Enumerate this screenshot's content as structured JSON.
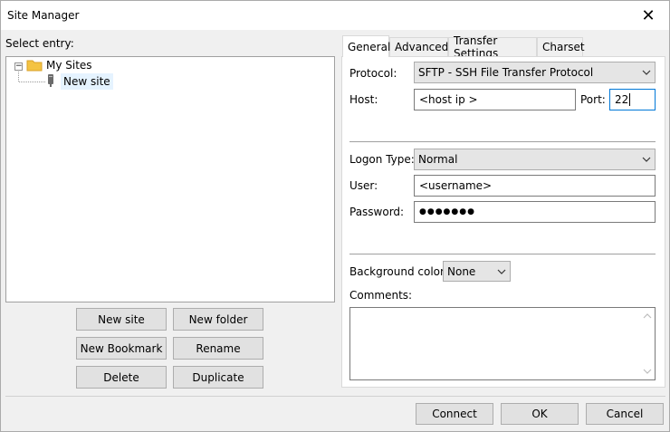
{
  "window": {
    "title": "Site Manager"
  },
  "left": {
    "select_entry_label": "Select entry:",
    "tree": {
      "root": {
        "label": "My Sites",
        "expanded": "−"
      },
      "child": {
        "label": "New site"
      }
    },
    "buttons": {
      "new_site": "New site",
      "new_folder": "New folder",
      "new_bookmark": "New Bookmark",
      "rename": "Rename",
      "delete": "Delete",
      "duplicate": "Duplicate"
    }
  },
  "tabs": [
    {
      "label": "General"
    },
    {
      "label": "Advanced"
    },
    {
      "label": "Transfer Settings"
    },
    {
      "label": "Charset"
    }
  ],
  "general": {
    "protocol_label": "Protocol:",
    "protocol_value": "SFTP - SSH File Transfer Protocol",
    "host_label": "Host:",
    "host_value": "<host ip >",
    "port_label": "Port:",
    "port_value": "22",
    "logon_type_label": "Logon Type:",
    "logon_type_value": "Normal",
    "user_label": "User:",
    "user_value": "<username>",
    "password_label": "Password:",
    "password_value": "●●●●●●●",
    "bg_color_label": "Background color:",
    "bg_color_value": "None",
    "comments_label": "Comments:",
    "comments_value": ""
  },
  "footer": {
    "connect": "Connect",
    "ok": "OK",
    "cancel": "Cancel"
  },
  "colors": {
    "selection": "#e5f3ff",
    "folder": "#f4c342",
    "focus_border": "#0078d7"
  }
}
